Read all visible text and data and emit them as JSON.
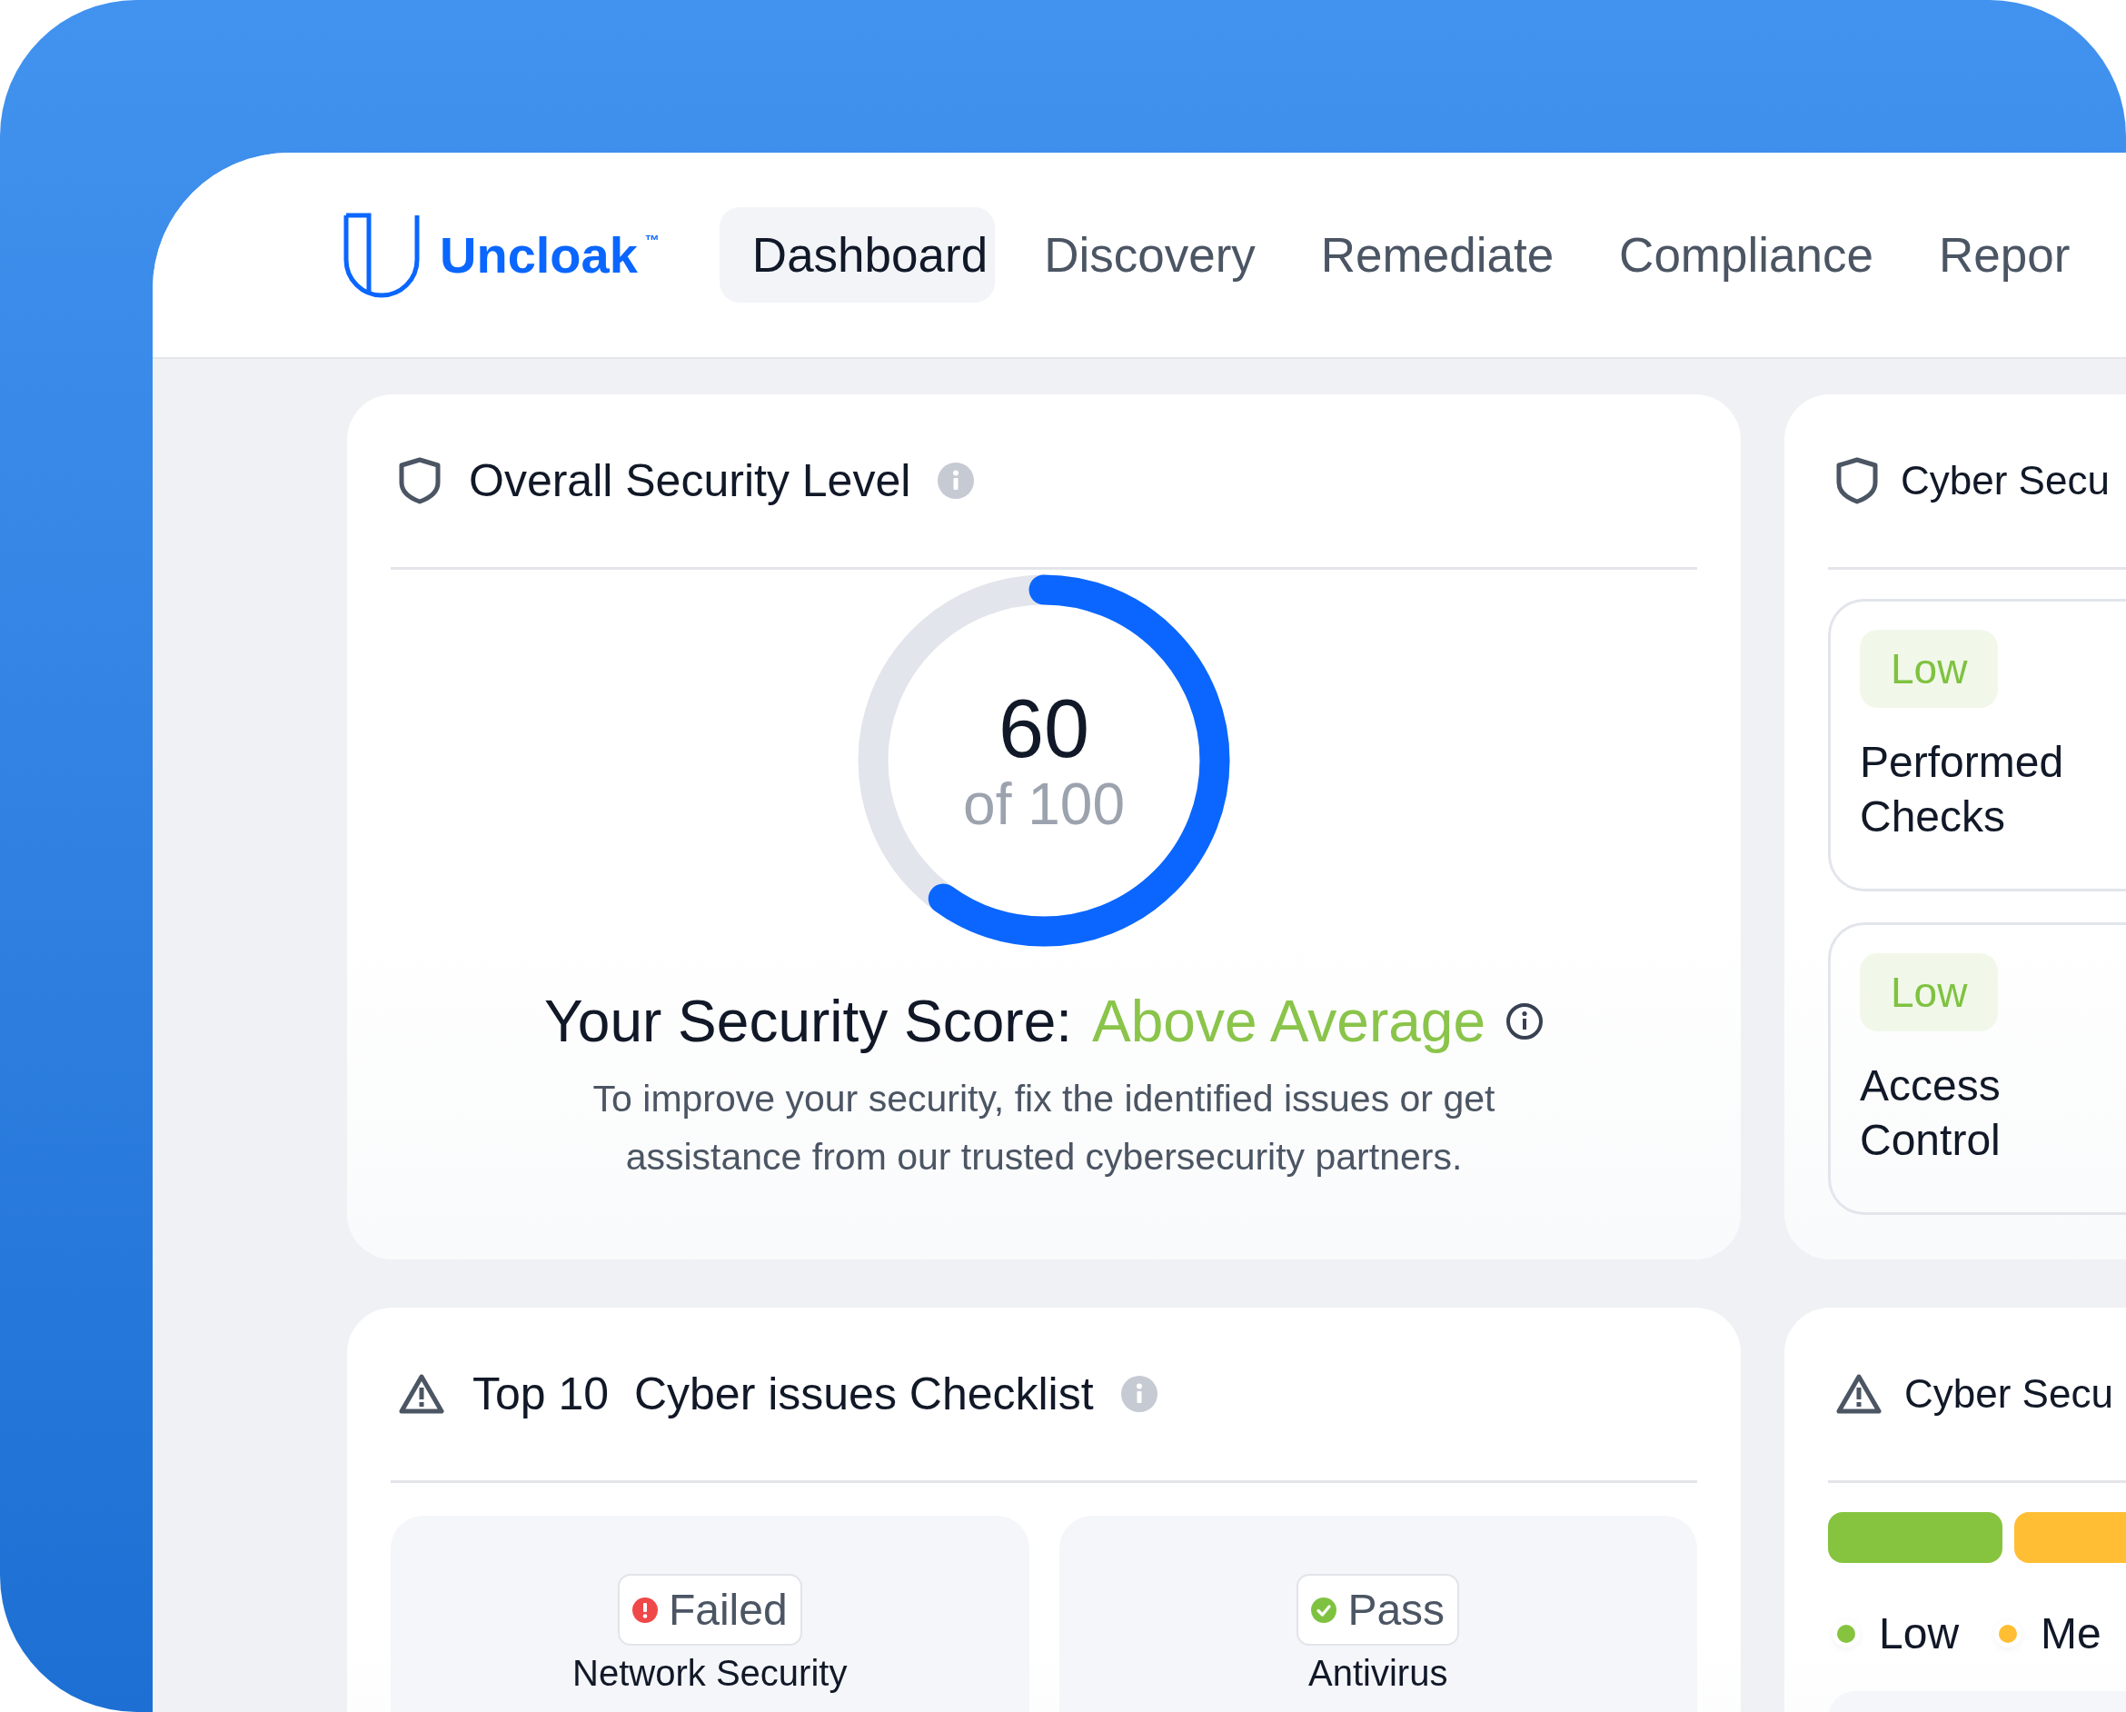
{
  "brand": {
    "name": "Uncloak",
    "trademark": "™"
  },
  "nav": [
    {
      "label": "Dashboard",
      "selected": true
    },
    {
      "label": "Discovery",
      "selected": false
    },
    {
      "label": "Remediate",
      "selected": false
    },
    {
      "label": "Compliance",
      "selected": false
    },
    {
      "label": "Repor",
      "selected": false
    }
  ],
  "security_level": {
    "title": "Overall Security Level",
    "score": "60",
    "out_of": "of 100",
    "level": 0.6,
    "score_label": "Your Security Score:",
    "rating": "Above Average",
    "description": "To improve your security, fix the identified issues or get assistance from our trusted cybersecurity partners."
  },
  "risk_panel": {
    "title": "Cyber Secu",
    "items": [
      {
        "badge": "Low",
        "label": "Performed Checks"
      },
      {
        "badge": "Low",
        "label": "Access Control"
      }
    ]
  },
  "checklist": {
    "title": "Top 10  Cyber issues Checklist",
    "items": [
      {
        "kind": "failed",
        "badge": "Failed",
        "label": "Network Security"
      },
      {
        "kind": "pass",
        "badge": "Pass",
        "label": "Antivirus"
      }
    ]
  },
  "distribution": {
    "title": "Cyber Secu",
    "levels": [
      {
        "label": "Low",
        "color": "#86c440"
      },
      {
        "label": "Me",
        "color": "#ffbe33"
      }
    ]
  }
}
